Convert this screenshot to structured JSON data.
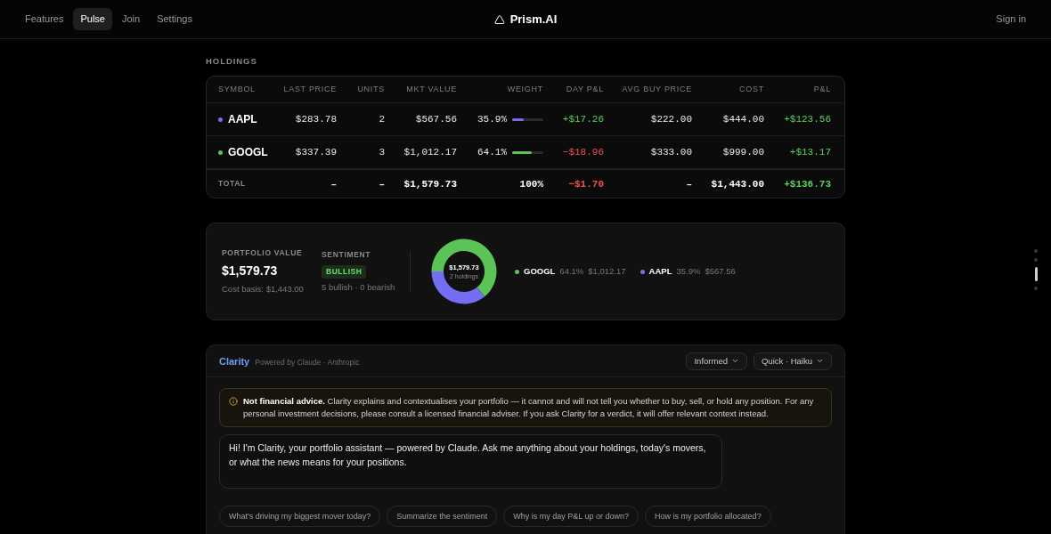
{
  "nav": {
    "links": [
      {
        "label": "Features",
        "selected": false
      },
      {
        "label": "Pulse",
        "selected": true
      },
      {
        "label": "Join",
        "selected": false
      },
      {
        "label": "Settings",
        "selected": false
      }
    ],
    "brand": "Prism.AI",
    "sign_in": "Sign in"
  },
  "holdings": {
    "title": "HOLDINGS",
    "columns": [
      "SYMBOL",
      "LAST PRICE",
      "UNITS",
      "MKT VALUE",
      "WEIGHT",
      "DAY P&L",
      "AVG BUY PRICE",
      "COST",
      "P&L"
    ],
    "rows": [
      {
        "symbol": "AAPL",
        "color": "#766ef2",
        "last_price": "$283.78",
        "units": "2",
        "mkt_value": "$567.56",
        "weight": "35.9%",
        "level": 0.359,
        "day_pl": {
          "text": "+$17.26",
          "negative": false
        },
        "avg_buy_price": "$222.00",
        "cost": "$444.00",
        "pl": {
          "text": "+$123.56",
          "negative": false
        }
      },
      {
        "symbol": "GOOGL",
        "color": "#5cc457",
        "last_price": "$337.39",
        "units": "3",
        "mkt_value": "$1,012.17",
        "weight": "64.1%",
        "level": 0.641,
        "day_pl": {
          "text": "−$18.96",
          "negative": true
        },
        "avg_buy_price": "$333.00",
        "cost": "$999.00",
        "pl": {
          "text": "+$13.17",
          "negative": false
        }
      }
    ],
    "total": {
      "label": "TOTAL",
      "last_price": "–",
      "units": "–",
      "mkt_value": "$1,579.73",
      "weight": "100%",
      "day_pl": {
        "text": "−$1.70",
        "negative": true
      },
      "avg_buy_price": "–",
      "cost": "$1,443.00",
      "pl": {
        "text": "+$136.73",
        "negative": false
      }
    }
  },
  "summary": {
    "portfolio_value": {
      "label": "PORTFOLIO VALUE",
      "value": "$1,579.73",
      "cost_basis": "Cost basis: $1,443.00"
    },
    "sentiment": {
      "label": "SENTIMENT",
      "badge": "BULLISH",
      "bullish": true,
      "counts": "5 bullish · 0 bearish"
    },
    "allocation": {
      "center_value": "$1,579.73",
      "center_caption": "2 holdings",
      "chart_data": {
        "type": "donut",
        "categories": [
          "GOOGL",
          "AAPL"
        ],
        "values": [
          64.1,
          35.9
        ]
      },
      "legend": [
        {
          "color": "#5cc457",
          "percent": "64.1%",
          "value": "$1,012.17"
        },
        {
          "color": "#766ef2",
          "percent": "35.9%",
          "value": "$567.56"
        }
      ]
    }
  },
  "assistant": {
    "title": "Clarity",
    "subtitle": "Powered by Claude · Anthropic",
    "selectors": [
      "Informed",
      "Quick · Haiku"
    ],
    "disclaimer": "**Not financial advice.** Clarity explains and contextualises your portfolio — it cannot and will not tell you whether to buy, sell, or hold any position. For any personal investment decisions, please consult a licensed financial adviser. If you ask Clarity for a verdict, it will offer relevant context instead.",
    "messages": [
      "Hi! I'm Clarity, your portfolio assistant — powered by Claude. Ask me anything about your holdings, today's movers, or what the news means for your positions."
    ],
    "suggestions": [
      "What's driving my biggest mover today?",
      "Summarize the sentiment",
      "Why is my day P&L up or down?",
      "How is my portfolio allocated?"
    ]
  },
  "page_dots": [
    {
      "selected": false
    },
    {
      "selected": false
    },
    {
      "selected": true
    },
    {
      "selected": false
    }
  ]
}
